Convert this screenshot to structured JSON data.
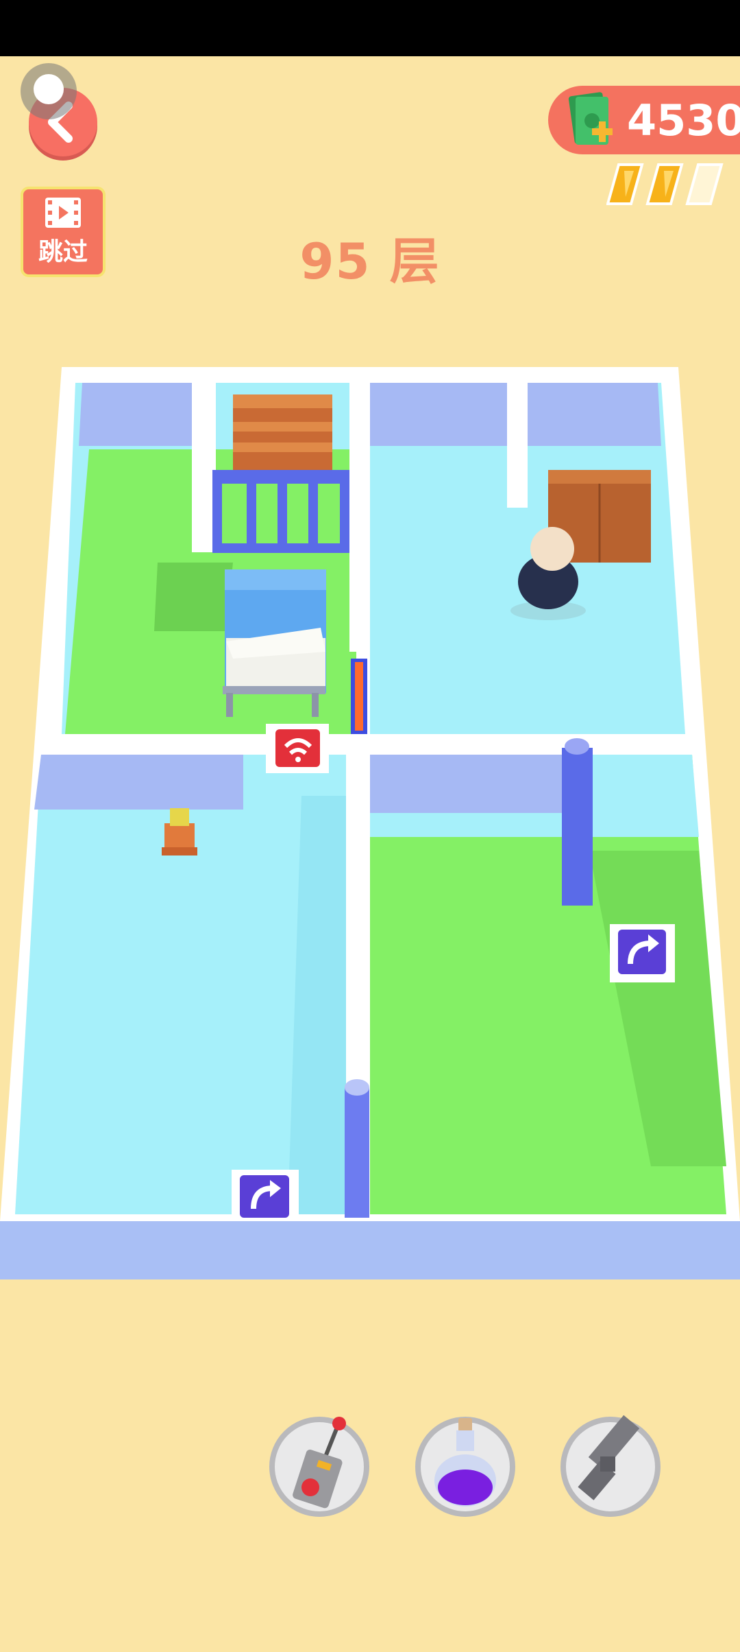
{
  "header": {
    "money": "4530",
    "level_title": "95 层",
    "skip_label": "跳过",
    "energy_total": 3,
    "energy_filled": 2
  },
  "tools": [
    {
      "name": "remote-control"
    },
    {
      "name": "poison-potion"
    },
    {
      "name": "pistol"
    }
  ],
  "colors": {
    "background": "#fbe5a5",
    "accent": "#f4725f",
    "floor_green": "#84f065",
    "floor_cyan": "#a7f1fb",
    "wall": "#a6b9f4"
  }
}
